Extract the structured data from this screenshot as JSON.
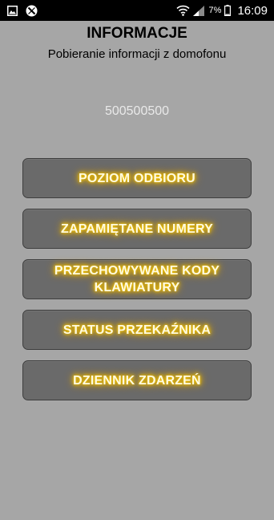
{
  "status_bar": {
    "battery_percent": "7%",
    "time": "16:09"
  },
  "header": {
    "title": "INFORMACJE",
    "subtitle": "Pobieranie informacji z domofonu"
  },
  "phone_number": "500500500",
  "menu": {
    "items": [
      {
        "label": "POZIOM ODBIORU"
      },
      {
        "label": "ZAPAMIĘTANE NUMERY"
      },
      {
        "label": "PRZECHOWYWANE KODY KLAWIATURY"
      },
      {
        "label": "STATUS PRZEKAŹNIKA"
      },
      {
        "label": "DZIENNIK ZDARZEŃ"
      }
    ]
  },
  "colors": {
    "background": "#a6a6a6",
    "button": "#6a6a6a",
    "button_text_glow": "#f2c200",
    "number_text": "#e9e9e9"
  }
}
